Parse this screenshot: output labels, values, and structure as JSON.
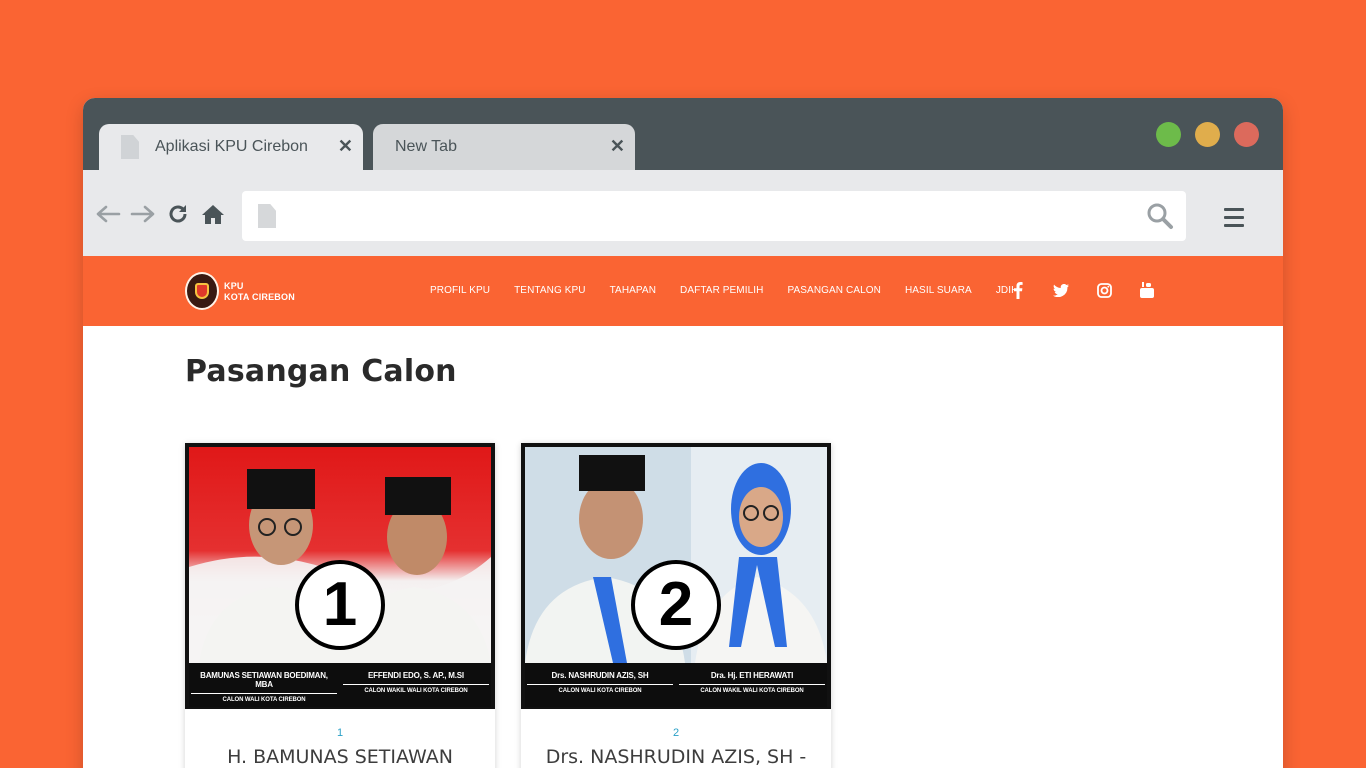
{
  "browser": {
    "tabs": [
      {
        "title": "Aplikasi KPU Cirebon",
        "close": "✕"
      },
      {
        "title": "New Tab",
        "close": "✕"
      }
    ],
    "window_controls": [
      {
        "name": "maximize",
        "color": "#6dbb4a"
      },
      {
        "name": "minimize",
        "color": "#e0ad4c"
      },
      {
        "name": "close",
        "color": "#dc6a5c"
      }
    ],
    "address_value": "",
    "nav_icons": [
      "back-arrow-icon",
      "forward-arrow-icon",
      "reload-icon",
      "home-icon"
    ]
  },
  "site": {
    "logo_line1": "KPU",
    "logo_line2": "KOTA CIREBON",
    "menu": [
      "PROFIL KPU",
      "TENTANG KPU",
      "TAHAPAN",
      "DAFTAR PEMILIH",
      "PASANGAN CALON",
      "HASIL SUARA",
      "JDIH"
    ],
    "social": [
      "facebook-icon",
      "twitter-icon",
      "instagram-icon",
      "youtube-icon"
    ],
    "brand_color": "#fa6433"
  },
  "page": {
    "title": "Pasangan Calon"
  },
  "candidates": [
    {
      "number": "1",
      "badge": "1",
      "name": "H. BAMUNAS SETIAWAN",
      "left_name": "BAMUNAS SETIAWAN BOEDIMAN, MBA",
      "left_role": "CALON WALI KOTA CIREBON",
      "right_name": "EFFENDI EDO, S. AP., M.SI",
      "right_role": "CALON WAKIL WALI KOTA CIREBON"
    },
    {
      "number": "2",
      "badge": "2",
      "name": "Drs. NASHRUDIN AZIS, SH -",
      "left_name": "Drs. NASHRUDIN AZIS, SH",
      "left_role": "CALON WALI KOTA CIREBON",
      "right_name": "Dra. Hj. ETI HERAWATI",
      "right_role": "CALON WAKIL WALI KOTA CIREBON"
    }
  ]
}
